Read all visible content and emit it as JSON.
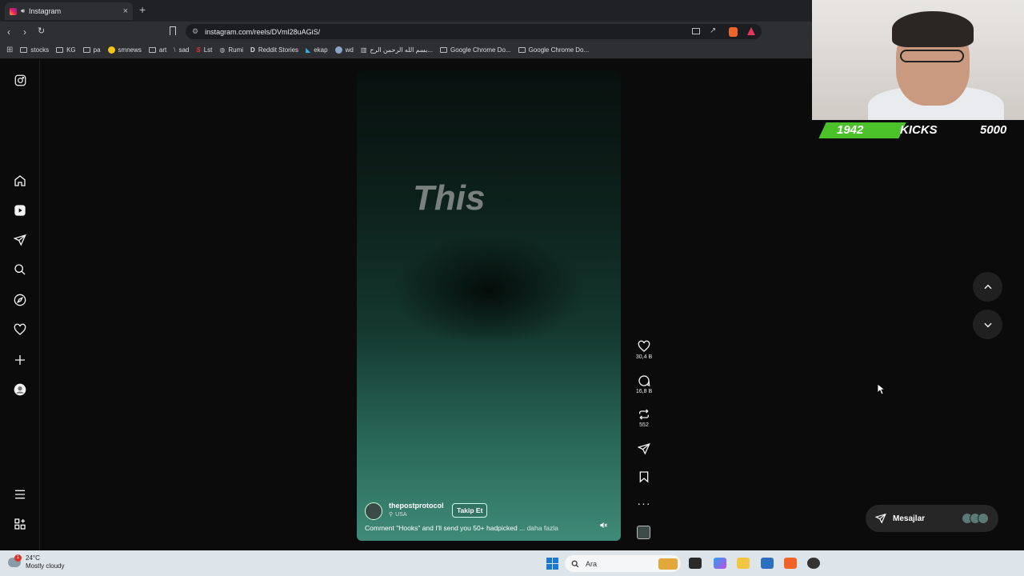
{
  "browser": {
    "tab_title": "Instagram",
    "tab_close": "×",
    "new_tab": "+",
    "url": "instagram.com/reels/DVml28uAGiS/",
    "bookmarks": [
      "stocks",
      "KG",
      "pa",
      "smnews",
      "art",
      "sad",
      "Lst",
      "Rumi",
      "Reddit Stories",
      "ekap",
      "wd",
      "بسم الله الرحمن الرح...",
      "Google Chrome Do...",
      "Google Chrome Do..."
    ]
  },
  "reel": {
    "overlay_text": "This",
    "username": "thepostprotocol",
    "location": "USA",
    "follow_label": "Takip Et",
    "caption": "Comment \"Hooks\" and I'll send you 50+ hadpicked ...",
    "more_label": "daha fazla"
  },
  "actions": {
    "likes": "30,4 B",
    "comments": "16,8 B",
    "reposts": "552"
  },
  "messages": {
    "label": "Mesajlar"
  },
  "stream_overlay": {
    "stat_left": "1942",
    "stat_middle": "KICKS",
    "stat_right": "5000"
  },
  "taskbar": {
    "temperature": "24°C",
    "condition": "Mostly cloudy",
    "search_placeholder": "Ara",
    "notification_count": "1"
  },
  "colors": {
    "accent_green": "#4bc22a",
    "reel_gradient_bottom": "#3f8a78"
  }
}
